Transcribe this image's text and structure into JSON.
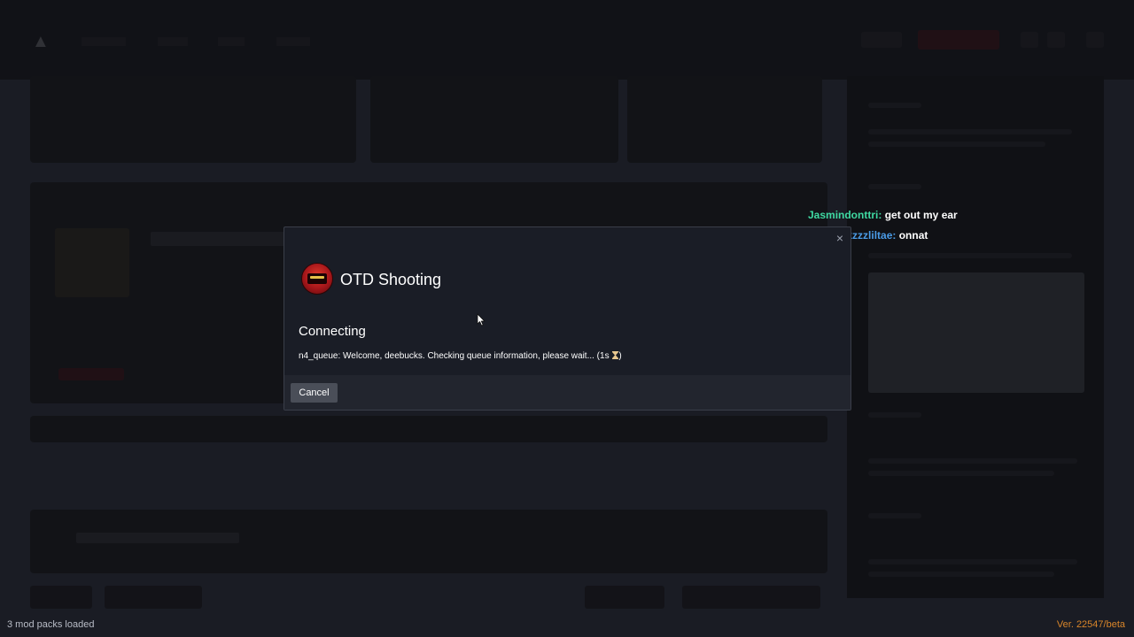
{
  "dialog": {
    "close_glyph": "×",
    "server_name": "OTD Shooting",
    "status_heading": "Connecting",
    "queue_message": "n4_queue: Welcome, deebucks. Checking queue information, please wait... (1s ",
    "queue_message_end": ")",
    "cancel_label": "Cancel"
  },
  "chat": [
    {
      "nick": "Jasmindonttri:",
      "message": "get out my ear"
    },
    {
      "nick": "freebuckzzzliltae:",
      "message": "onnat"
    }
  ],
  "status_bar": {
    "left": "3 mod packs loaded",
    "right": "Ver. 22547/beta"
  },
  "colors": {
    "chat_nick_1": "#3fd9a2",
    "chat_nick_2": "#4a9be6",
    "version_text": "#d8852a",
    "dialog_bg": "#1a1d26"
  }
}
